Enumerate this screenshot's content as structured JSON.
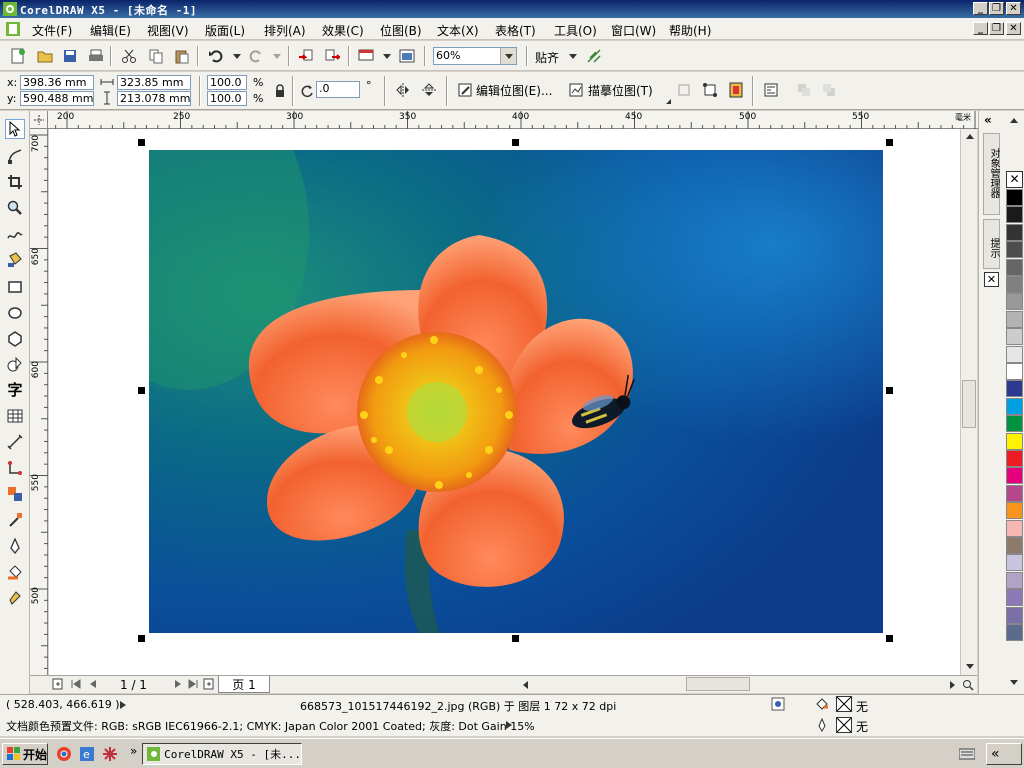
{
  "window": {
    "title": "CorelDRAW X5 - [未命名 -1]",
    "controls": [
      "_",
      "❐",
      "✕"
    ]
  },
  "menu": {
    "items": [
      "文件(F)",
      "编辑(E)",
      "视图(V)",
      "版面(L)",
      "排列(A)",
      "效果(C)",
      "位图(B)",
      "文本(X)",
      "表格(T)",
      "工具(O)",
      "窗口(W)",
      "帮助(H)"
    ]
  },
  "standard_toolbar": {
    "zoom": "60%",
    "snap_label": "贴齐"
  },
  "property_bar": {
    "x_label": "x:",
    "x_value": "398.36 mm",
    "y_label": "y:",
    "y_value": "590.488 mm",
    "width_value": "323.85 mm",
    "height_value": "213.078 mm",
    "scale_x": "100.0",
    "scale_y": "100.0",
    "percent": "%",
    "rotation": ".0",
    "degree": "°",
    "edit_bitmap": "编辑位图(E)...",
    "trace_bitmap": "描摹位图(T)"
  },
  "rulers": {
    "unit": "毫米",
    "h_labels": [
      "200",
      "250",
      "300",
      "350",
      "400",
      "450",
      "500",
      "550"
    ],
    "v_labels": [
      "700",
      "650",
      "600",
      "550",
      "500"
    ]
  },
  "page_nav": {
    "page_count": "1 / 1",
    "tab": "页 1"
  },
  "dockers": {
    "object_manager": "对象管理器",
    "hints": "提示"
  },
  "palette": {
    "colors": [
      "#000000",
      "#1a1a1a",
      "#333333",
      "#4d4d4d",
      "#666666",
      "#808080",
      "#999999",
      "#b3b3b3",
      "#cccccc",
      "#e6e6e6",
      "#ffffff",
      "#2b3990",
      "#00a0e3",
      "#00923f",
      "#fff200",
      "#ed1c24",
      "#e6007e",
      "#b5478d",
      "#f7941d",
      "#f5b7b1",
      "#8c7b6b",
      "#c7c3e0",
      "#b3a2c8",
      "#8c79b6",
      "#7b6fa8",
      "#5c6a8c"
    ]
  },
  "status": {
    "cursor": "( 528.403, 466.619 )",
    "object_info": "668573_101517446192_2.jpg (RGB) 于 图层 1 72 x 72 dpi",
    "color_profile": "文档颜色预置文件: RGB: sRGB IEC61966-2.1; CMYK: Japan Color 2001 Coated; 灰度: Dot Gain 15%",
    "fill_label": "无",
    "outline_label": "无"
  },
  "taskbar": {
    "start": "开始",
    "task": "CorelDRAW X5 - [未...",
    "chevron": "»"
  }
}
